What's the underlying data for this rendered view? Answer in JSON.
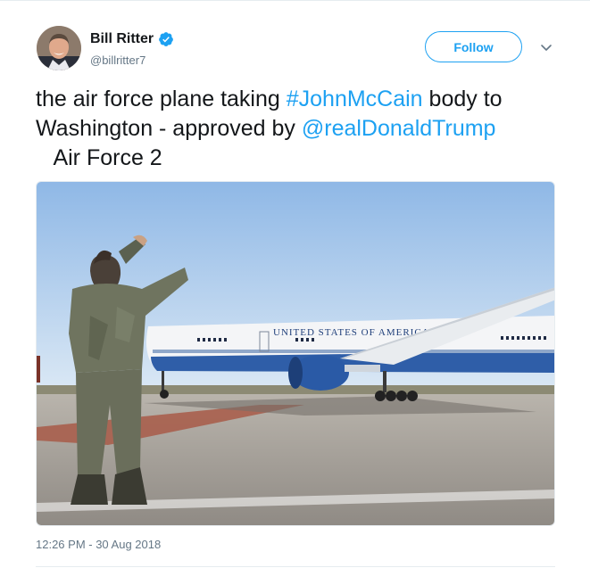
{
  "author": {
    "display_name": "Bill Ritter",
    "handle": "@billritter7",
    "verified": true
  },
  "follow_label": "Follow",
  "tweet": {
    "segments": [
      {
        "text": "the air force plane taking ",
        "type": "text"
      },
      {
        "text": "#JohnMcCain",
        "type": "hashtag"
      },
      {
        "text": " body to Washington - approved by ",
        "type": "text"
      },
      {
        "text": "@realDonaldTrump",
        "type": "mention"
      },
      {
        "text": "   Air Force 2",
        "type": "text"
      }
    ]
  },
  "media": {
    "plane_lettering": "UNITED STATES OF AMERICA"
  },
  "timestamp": "12:26 PM - 30 Aug 2018",
  "colors": {
    "accent": "#1da1f2",
    "text": "#14171a",
    "muted": "#657786"
  },
  "icons": [
    "verified-badge-icon",
    "chevron-down-icon"
  ]
}
